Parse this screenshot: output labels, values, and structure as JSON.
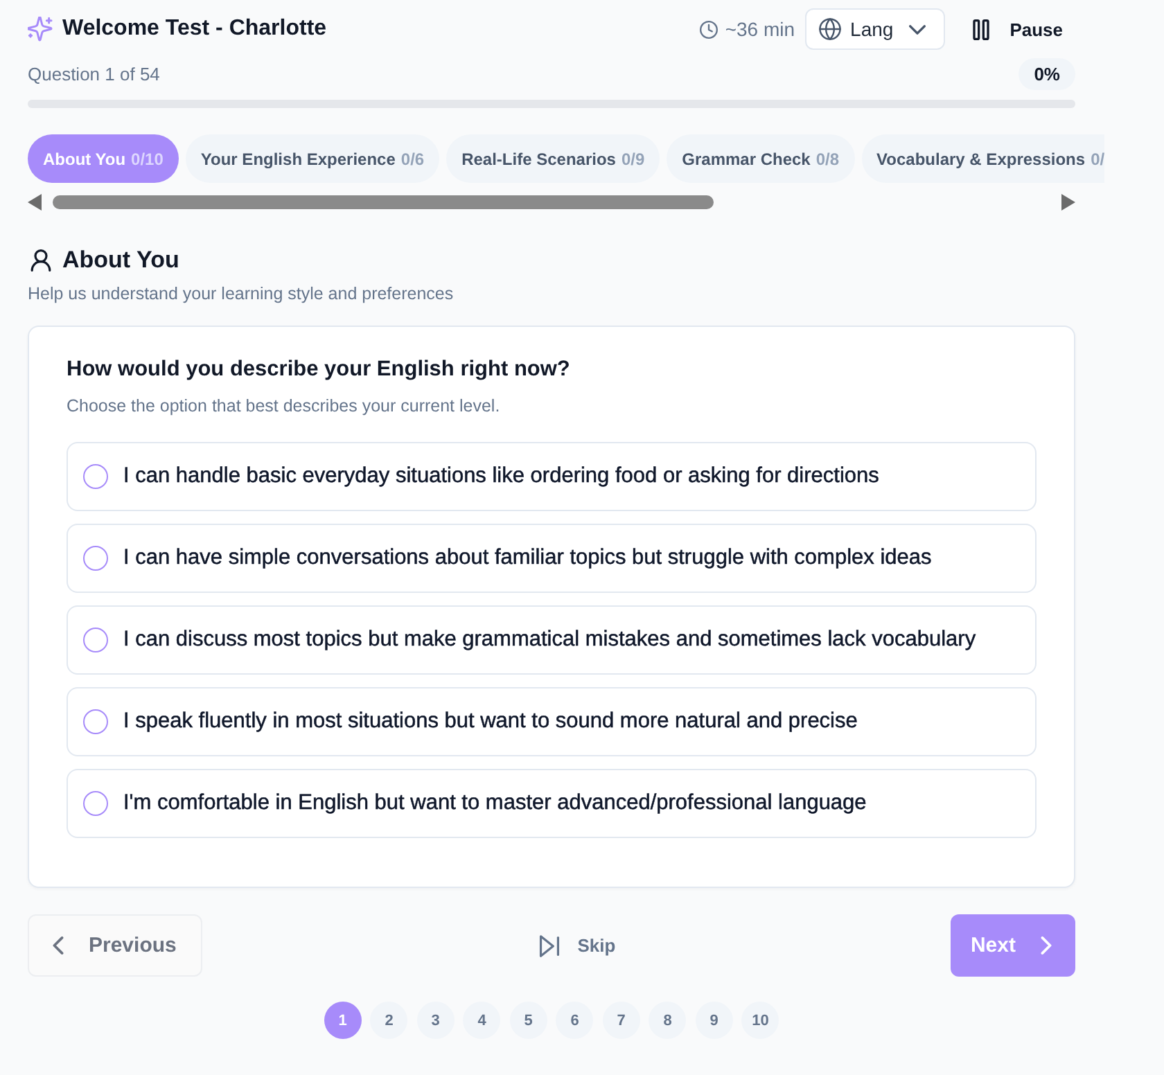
{
  "header": {
    "title": "Welcome Test - Charlotte",
    "time": "~36 min",
    "language": "Lang",
    "pause": "Pause"
  },
  "progress": {
    "question": "Question 1 of 54",
    "percent": "0%",
    "level": 0
  },
  "sections": [
    {
      "label": "About You",
      "count": "0/10",
      "selected": true
    },
    {
      "label": "Your English Experience",
      "count": "0/6",
      "selected": false
    },
    {
      "label": "Real-Life Scenarios",
      "count": "0/9",
      "selected": false
    },
    {
      "label": "Grammar Check",
      "count": "0/8",
      "selected": false
    },
    {
      "label": "Vocabulary & Expressions",
      "count": "0/",
      "selected": false
    }
  ],
  "section": {
    "title": "About You",
    "subtitle": "Help us understand your learning style and preferences"
  },
  "question": {
    "text": "How would you describe your English right now?",
    "hint": "Choose the option that best describes your current level.",
    "options": [
      {
        "label": "I can handle basic everyday situations like ordering food or asking for directions",
        "selected": false
      },
      {
        "label": "I can have simple conversations about familiar topics but struggle with complex ideas",
        "selected": false
      },
      {
        "label": "I can discuss most topics but make grammatical mistakes and sometimes lack vocabulary",
        "selected": false
      },
      {
        "label": "I speak fluently in most situations but want to sound more natural and precise",
        "selected": false
      },
      {
        "label": "I'm comfortable in English but want to master advanced/professional language",
        "selected": false
      }
    ]
  },
  "nav": {
    "previous": {
      "label": "Previous",
      "disabled": true
    },
    "skip": {
      "label": "Skip"
    },
    "next": {
      "label": "Next",
      "disabled": false
    }
  },
  "pages": [
    {
      "label": "1",
      "selected": true
    },
    {
      "label": "2",
      "selected": false
    },
    {
      "label": "3",
      "selected": false
    },
    {
      "label": "4",
      "selected": false
    },
    {
      "label": "5",
      "selected": false
    },
    {
      "label": "6",
      "selected": false
    },
    {
      "label": "7",
      "selected": false
    },
    {
      "label": "8",
      "selected": false
    },
    {
      "label": "9",
      "selected": false
    },
    {
      "label": "10",
      "selected": false
    }
  ]
}
